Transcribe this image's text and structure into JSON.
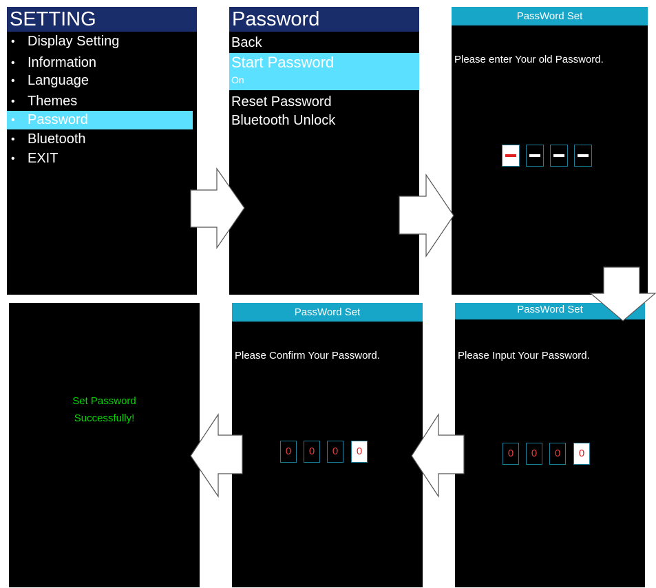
{
  "setting_screen": {
    "title": "SETTING",
    "bullet": "•",
    "items": [
      {
        "label": "Display Setting"
      },
      {
        "label": "Information"
      },
      {
        "label": "Language"
      },
      {
        "label": "Themes"
      },
      {
        "label": "Password",
        "selected": true
      },
      {
        "label": "Bluetooth"
      },
      {
        "label": "EXIT"
      }
    ],
    "colors": {
      "header": "#1a2d6b",
      "highlight": "#5ce0ff"
    }
  },
  "password_screen": {
    "title": "Password",
    "back_label": "Back",
    "start_password_label": "Start Password",
    "start_password_value": "On",
    "reset_password_label": "Reset Password",
    "bluetooth_unlock_label": "Bluetooth Unlock"
  },
  "old_password_screen": {
    "title": "PassWord Set",
    "prompt": "Please enter Your old Password."
  },
  "input_password_screen": {
    "title": "PassWord Set",
    "prompt": "Please Input Your Password.",
    "digits": [
      "0",
      "0",
      "0",
      "0"
    ]
  },
  "confirm_password_screen": {
    "title": "PassWord Set",
    "prompt": "Please Confirm Your Password.",
    "digits": [
      "0",
      "0",
      "0",
      "0"
    ]
  },
  "success_screen": {
    "line1": "Set Password",
    "line2": "Successfully!",
    "color": "#00d800"
  }
}
